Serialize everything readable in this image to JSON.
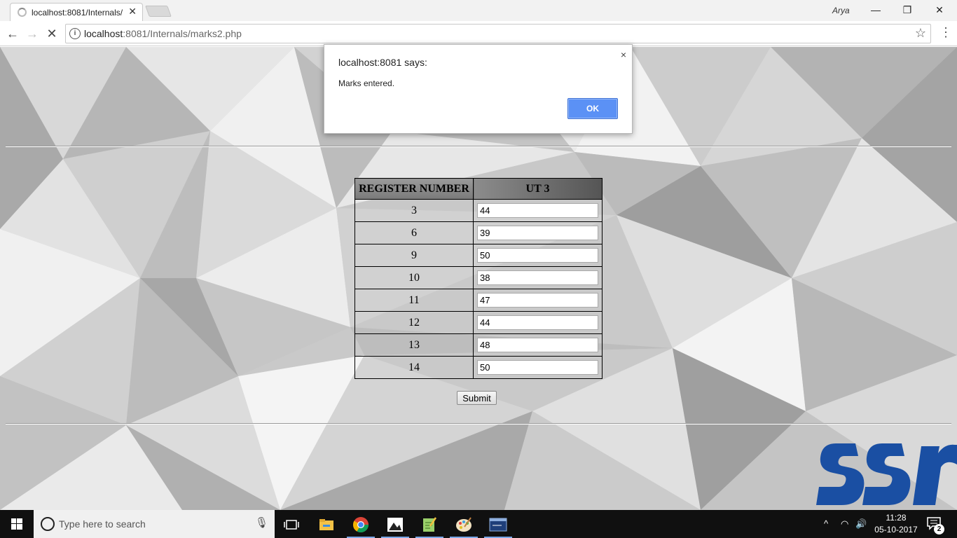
{
  "browser": {
    "tab_title": "localhost:8081/Internals/",
    "user_name": "Arya",
    "url_host": "localhost",
    "url_rest": ":8081/Internals/marks2.php"
  },
  "icons": {
    "back": "←",
    "forward": "→",
    "stop": "✕",
    "star": "☆",
    "menu": "⋮",
    "minimize": "—",
    "restore": "❐",
    "close": "✕",
    "tab_close": "✕",
    "dialog_close": "×",
    "info": "i",
    "mic": "🎙",
    "tray_up": "^",
    "wifi": "◠",
    "volume": "🔊"
  },
  "alert": {
    "title": "localhost:8081 says:",
    "message": "Marks entered.",
    "ok_label": "OK"
  },
  "table": {
    "headers": [
      "REGISTER NUMBER",
      "UT 3"
    ],
    "rows": [
      {
        "reg": "3",
        "mark": "44"
      },
      {
        "reg": "6",
        "mark": "39"
      },
      {
        "reg": "9",
        "mark": "50"
      },
      {
        "reg": "10",
        "mark": "38"
      },
      {
        "reg": "11",
        "mark": "47"
      },
      {
        "reg": "12",
        "mark": "44"
      },
      {
        "reg": "13",
        "mark": "48"
      },
      {
        "reg": "14",
        "mark": "50"
      }
    ]
  },
  "form": {
    "submit_label": "Submit"
  },
  "taskbar": {
    "search_placeholder": "Type here to search",
    "time": "11:28",
    "date": "05-10-2017",
    "notification_count": "2"
  },
  "colors": {
    "ok_button": "#5b91f5",
    "logo_blue": "#1a4fa3",
    "taskbar": "#101010"
  }
}
